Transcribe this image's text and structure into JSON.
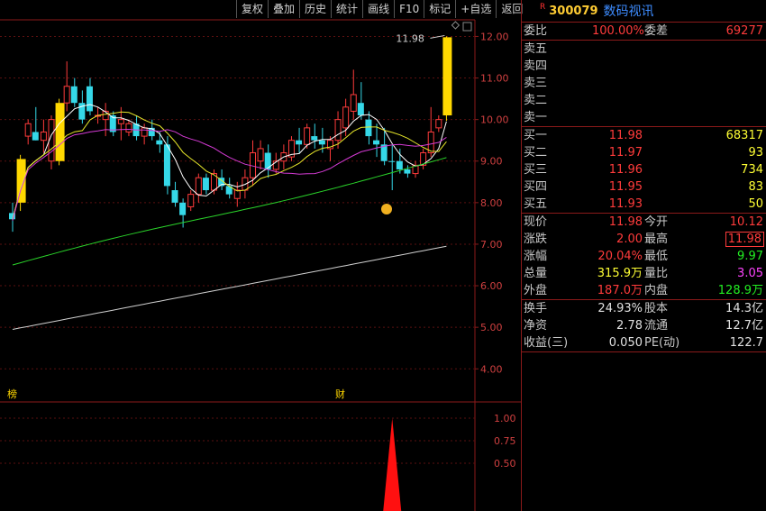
{
  "toolbar": {
    "fuquan": "复权",
    "diejia": "叠加",
    "lishi": "历史",
    "tongji": "统计",
    "huaxian": "画线",
    "f10": "F10",
    "biaoji": "标记",
    "zixuan": "+自选",
    "fanhui": "返回"
  },
  "stock": {
    "badge": "R",
    "code": "300079",
    "name": "数码视讯"
  },
  "order_ratio": {
    "label": "委比",
    "value": "100.00%",
    "diff_label": "委差",
    "diff_value": "69277"
  },
  "asks": [
    {
      "label": "卖五",
      "price": "",
      "vol": ""
    },
    {
      "label": "卖四",
      "price": "",
      "vol": ""
    },
    {
      "label": "卖三",
      "price": "",
      "vol": ""
    },
    {
      "label": "卖二",
      "price": "",
      "vol": ""
    },
    {
      "label": "卖一",
      "price": "",
      "vol": ""
    }
  ],
  "bids": [
    {
      "label": "买一",
      "price": "11.98",
      "vol": "68317"
    },
    {
      "label": "买二",
      "price": "11.97",
      "vol": "93"
    },
    {
      "label": "买三",
      "price": "11.96",
      "vol": "734"
    },
    {
      "label": "买四",
      "price": "11.95",
      "vol": "83"
    },
    {
      "label": "买五",
      "price": "11.93",
      "vol": "50"
    }
  ],
  "quote": {
    "xianjia_l": "现价",
    "xianjia": "11.98",
    "jinkai_l": "今开",
    "jinkai": "10.12",
    "zhangdie_l": "涨跌",
    "zhangdie": "2.00",
    "zuigao_l": "最高",
    "zuigao": "11.98",
    "zhangfu_l": "涨幅",
    "zhangfu": "20.04%",
    "zuidi_l": "最低",
    "zuidi": "9.97",
    "zongliang_l": "总量",
    "zongliang": "315.9万",
    "liangbi_l": "量比",
    "liangbi": "3.05",
    "waipan_l": "外盘",
    "waipan": "187.0万",
    "neipan_l": "内盘",
    "neipan": "128.9万"
  },
  "fundamentals": {
    "huanshou_l": "换手",
    "huanshou": "24.93%",
    "guben_l": "股本",
    "guben": "14.3亿",
    "jingzi_l": "净资",
    "jingzi": "2.78",
    "liutong_l": "流通",
    "liutong": "12.7亿",
    "shouyi_l": "收益(三)",
    "shouyi": "0.050",
    "pe_l": "PE(动)",
    "pe": "122.7"
  },
  "markers": {
    "bang": "榜",
    "cai": "财"
  },
  "colors": {
    "up": "#ff3b3b",
    "down": "#35d8e8",
    "limit_up": "#ffd800",
    "ma5": "#ffffff",
    "ma10": "#e6e62a",
    "ma20": "#d43ad4",
    "ma60": "#2ad42a",
    "ma120": "#d0d0d0"
  },
  "chart_data": {
    "type": "candlestick",
    "price_axis": {
      "ticks": [
        "12.00",
        "11.00",
        "10.00",
        "9.00",
        "8.00",
        "7.00",
        "6.00",
        "5.00",
        "4.00"
      ],
      "range": [
        3.55,
        12.4
      ]
    },
    "last_price_label": "11.98",
    "candles": [
      {
        "o": 7.75,
        "h": 8.0,
        "l": 7.3,
        "c": 7.6,
        "t": "down"
      },
      {
        "o": 8.0,
        "h": 9.15,
        "l": 7.8,
        "c": 9.05,
        "t": "limit"
      },
      {
        "o": 9.6,
        "h": 10.0,
        "l": 9.4,
        "c": 9.9,
        "t": "up"
      },
      {
        "o": 9.7,
        "h": 10.3,
        "l": 9.5,
        "c": 9.5,
        "t": "down"
      },
      {
        "o": 9.5,
        "h": 10.0,
        "l": 9.2,
        "c": 9.7,
        "t": "up"
      },
      {
        "o": 9.0,
        "h": 10.1,
        "l": 8.8,
        "c": 10.0,
        "t": "up"
      },
      {
        "o": 9.0,
        "h": 10.5,
        "l": 8.9,
        "c": 10.4,
        "t": "limit"
      },
      {
        "o": 10.4,
        "h": 11.4,
        "l": 10.2,
        "c": 10.8,
        "t": "up"
      },
      {
        "o": 10.8,
        "h": 11.0,
        "l": 10.3,
        "c": 10.4,
        "t": "down"
      },
      {
        "o": 10.4,
        "h": 10.7,
        "l": 9.9,
        "c": 10.0,
        "t": "down"
      },
      {
        "o": 10.8,
        "h": 11.0,
        "l": 10.1,
        "c": 10.2,
        "t": "down"
      },
      {
        "o": 10.1,
        "h": 10.3,
        "l": 9.9,
        "c": 10.1,
        "t": "up"
      },
      {
        "o": 10.0,
        "h": 10.4,
        "l": 9.6,
        "c": 10.2,
        "t": "up"
      },
      {
        "o": 10.1,
        "h": 10.2,
        "l": 9.6,
        "c": 9.7,
        "t": "down"
      },
      {
        "o": 9.9,
        "h": 10.3,
        "l": 9.5,
        "c": 10.0,
        "t": "up"
      },
      {
        "o": 9.7,
        "h": 10.0,
        "l": 9.6,
        "c": 9.9,
        "t": "up"
      },
      {
        "o": 9.9,
        "h": 10.1,
        "l": 9.5,
        "c": 9.6,
        "t": "down"
      },
      {
        "o": 9.6,
        "h": 9.9,
        "l": 9.4,
        "c": 9.8,
        "t": "up"
      },
      {
        "o": 9.8,
        "h": 10.0,
        "l": 9.5,
        "c": 9.6,
        "t": "down"
      },
      {
        "o": 9.5,
        "h": 9.7,
        "l": 9.2,
        "c": 9.4,
        "t": "down"
      },
      {
        "o": 9.4,
        "h": 9.6,
        "l": 8.2,
        "c": 8.4,
        "t": "down"
      },
      {
        "o": 8.3,
        "h": 8.5,
        "l": 7.9,
        "c": 8.0,
        "t": "down"
      },
      {
        "o": 8.0,
        "h": 8.1,
        "l": 7.4,
        "c": 7.7,
        "t": "down"
      },
      {
        "o": 7.9,
        "h": 8.3,
        "l": 7.8,
        "c": 8.2,
        "t": "up"
      },
      {
        "o": 8.2,
        "h": 8.7,
        "l": 8.0,
        "c": 8.6,
        "t": "up"
      },
      {
        "o": 8.6,
        "h": 8.7,
        "l": 8.2,
        "c": 8.3,
        "t": "down"
      },
      {
        "o": 8.3,
        "h": 8.8,
        "l": 8.2,
        "c": 8.7,
        "t": "up"
      },
      {
        "o": 8.6,
        "h": 8.8,
        "l": 8.3,
        "c": 8.4,
        "t": "down"
      },
      {
        "o": 8.4,
        "h": 8.6,
        "l": 8.1,
        "c": 8.2,
        "t": "down"
      },
      {
        "o": 8.1,
        "h": 8.5,
        "l": 7.9,
        "c": 8.3,
        "t": "up"
      },
      {
        "o": 8.3,
        "h": 8.8,
        "l": 8.1,
        "c": 8.6,
        "t": "up"
      },
      {
        "o": 8.6,
        "h": 9.5,
        "l": 8.4,
        "c": 9.2,
        "t": "up"
      },
      {
        "o": 9.0,
        "h": 9.5,
        "l": 8.8,
        "c": 9.3,
        "t": "up"
      },
      {
        "o": 9.2,
        "h": 9.4,
        "l": 8.6,
        "c": 8.8,
        "t": "down"
      },
      {
        "o": 8.8,
        "h": 9.2,
        "l": 8.7,
        "c": 9.0,
        "t": "up"
      },
      {
        "o": 9.0,
        "h": 9.4,
        "l": 8.8,
        "c": 9.2,
        "t": "up"
      },
      {
        "o": 9.1,
        "h": 9.6,
        "l": 9.0,
        "c": 9.5,
        "t": "up"
      },
      {
        "o": 9.5,
        "h": 9.8,
        "l": 9.2,
        "c": 9.4,
        "t": "down"
      },
      {
        "o": 9.4,
        "h": 9.9,
        "l": 9.3,
        "c": 9.8,
        "t": "up"
      },
      {
        "o": 9.6,
        "h": 9.9,
        "l": 9.3,
        "c": 9.5,
        "t": "down"
      },
      {
        "o": 9.5,
        "h": 9.8,
        "l": 9.2,
        "c": 9.4,
        "t": "down"
      },
      {
        "o": 9.3,
        "h": 9.6,
        "l": 9.0,
        "c": 9.5,
        "t": "up"
      },
      {
        "o": 9.5,
        "h": 10.2,
        "l": 9.3,
        "c": 10.0,
        "t": "up"
      },
      {
        "o": 9.8,
        "h": 10.5,
        "l": 9.6,
        "c": 10.3,
        "t": "up"
      },
      {
        "o": 10.2,
        "h": 11.2,
        "l": 10.0,
        "c": 10.6,
        "t": "up"
      },
      {
        "o": 10.4,
        "h": 10.9,
        "l": 10.0,
        "c": 10.1,
        "t": "down"
      },
      {
        "o": 10.0,
        "h": 10.2,
        "l": 9.4,
        "c": 9.6,
        "t": "down"
      },
      {
        "o": 9.5,
        "h": 9.9,
        "l": 9.1,
        "c": 9.4,
        "t": "down"
      },
      {
        "o": 9.4,
        "h": 9.8,
        "l": 8.9,
        "c": 9.0,
        "t": "down"
      },
      {
        "o": 9.0,
        "h": 9.4,
        "l": 8.3,
        "c": 9.0,
        "t": "down"
      },
      {
        "o": 9.0,
        "h": 9.3,
        "l": 8.7,
        "c": 8.8,
        "t": "down"
      },
      {
        "o": 8.8,
        "h": 8.9,
        "l": 8.6,
        "c": 8.7,
        "t": "down"
      },
      {
        "o": 8.7,
        "h": 9.0,
        "l": 8.6,
        "c": 8.9,
        "t": "up"
      },
      {
        "o": 8.9,
        "h": 9.3,
        "l": 8.8,
        "c": 9.2,
        "t": "up"
      },
      {
        "o": 9.2,
        "h": 10.3,
        "l": 9.1,
        "c": 9.7,
        "t": "up"
      },
      {
        "o": 9.8,
        "h": 10.1,
        "l": 9.7,
        "c": 10.0,
        "t": "up"
      },
      {
        "o": 10.1,
        "h": 12.0,
        "l": 9.97,
        "c": 11.98,
        "t": "limit"
      }
    ],
    "indicator": {
      "ticks": [
        "1.00",
        "0.75",
        "0.50"
      ],
      "spike_value": 1.0,
      "spike_index": 49
    }
  }
}
